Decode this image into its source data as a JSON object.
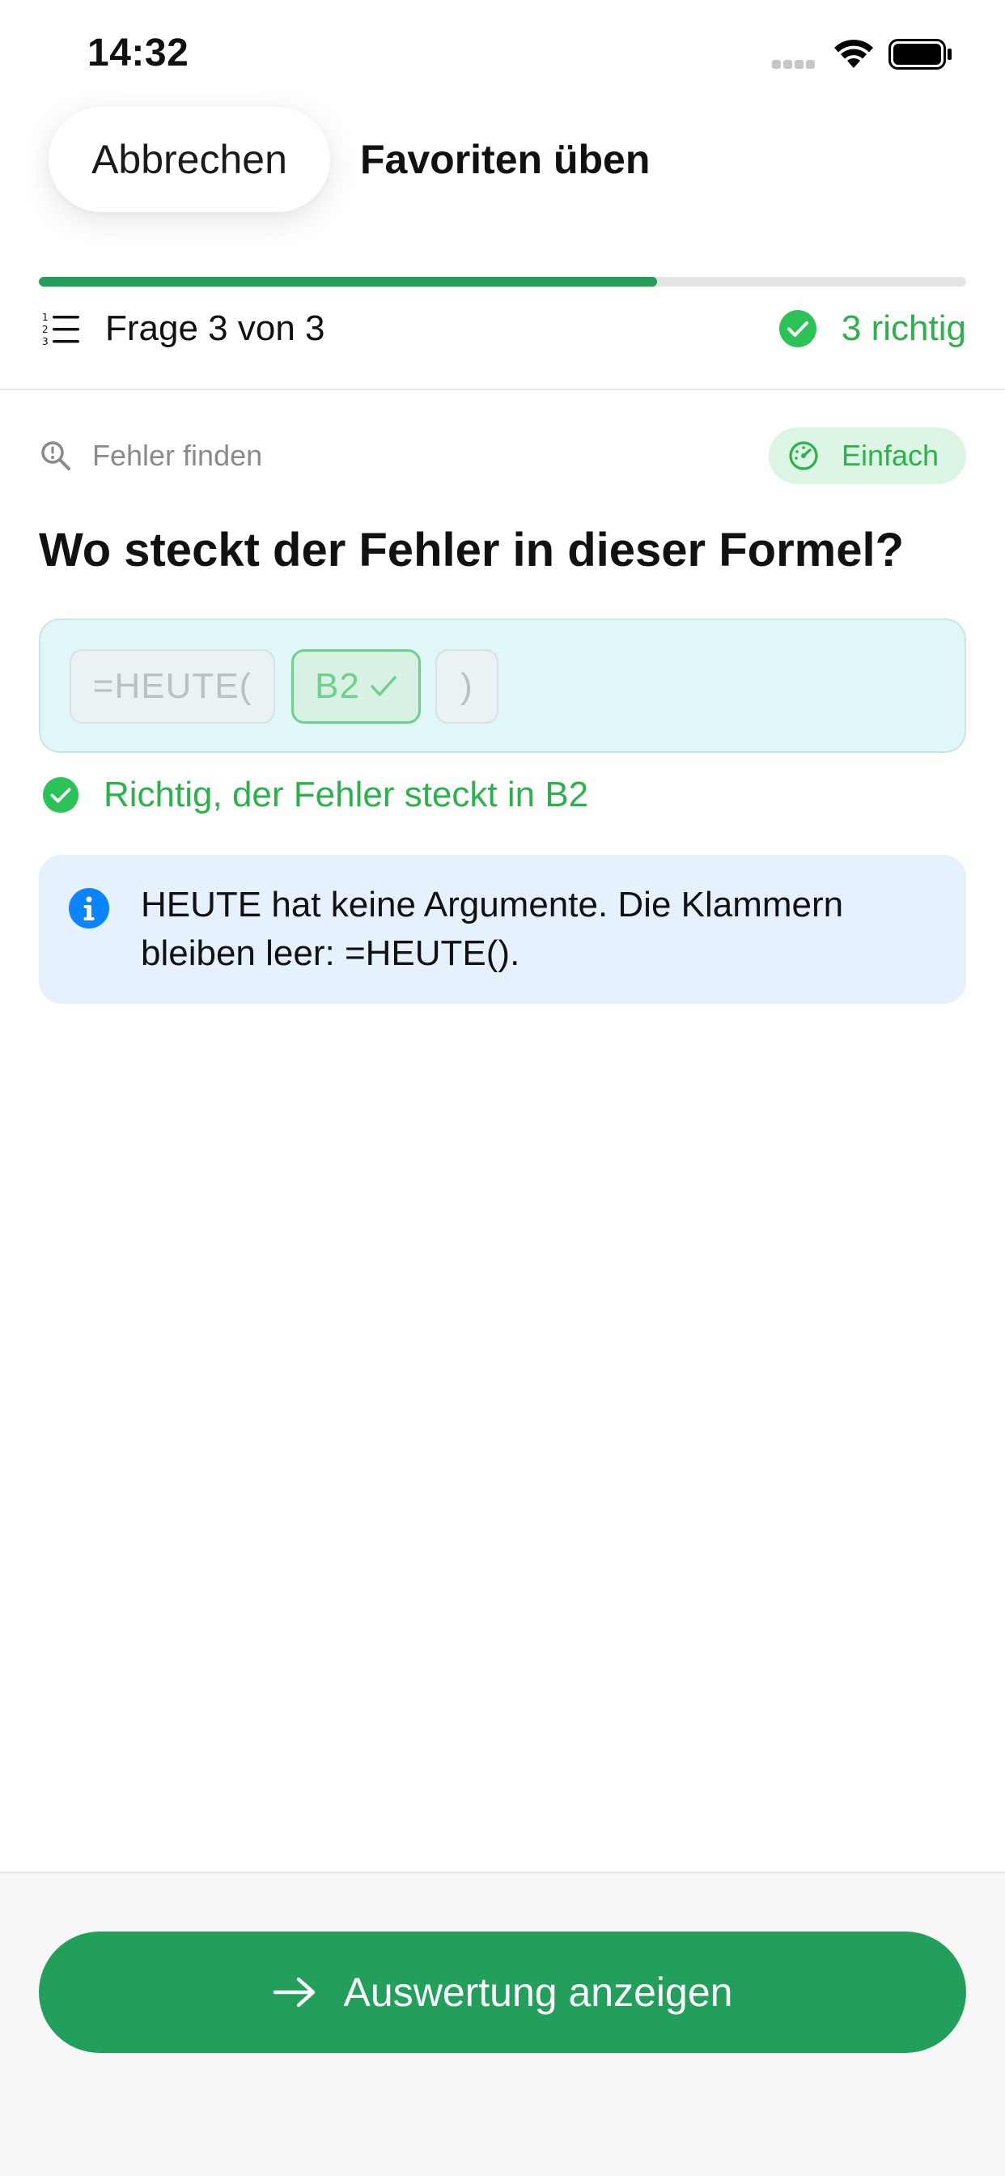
{
  "status_bar": {
    "time": "14:32",
    "signal_icon": "cellular-dots-icon",
    "wifi_icon": "wifi-icon",
    "battery_icon": "battery-icon"
  },
  "nav": {
    "cancel_label": "Abbrechen",
    "title": "Favoriten üben"
  },
  "progress": {
    "fraction": 0.667,
    "counter_label": "Frage 3 von 3",
    "counter_icon": "numbered-list-icon",
    "correct_label": "3 richtig",
    "correct_icon": "checkmark-circle-icon"
  },
  "question": {
    "category_label": "Fehler finden",
    "category_icon": "magnifier-exclamation-icon",
    "difficulty_label": "Einfach",
    "difficulty_icon": "gauge-icon",
    "text": "Wo steckt der Fehler in dieser Formel?",
    "tokens": [
      {
        "text": "=HEUTE(",
        "state": "neutral"
      },
      {
        "text": "B2",
        "state": "correct"
      },
      {
        "text": ")",
        "state": "neutral"
      }
    ]
  },
  "feedback": {
    "label": "Richtig, der Fehler steckt in B2",
    "icon": "checkmark-circle-icon"
  },
  "info": {
    "icon": "info-circle-icon",
    "text": "HEUTE hat keine Argumente. Die Klammern bleiben leer: =HEUTE()."
  },
  "footer": {
    "button_label": "Auswertung anzeigen",
    "button_icon": "arrow-right-icon"
  },
  "colors": {
    "accent": "#229f5b",
    "success": "#2bb24c",
    "info": "#0a84ff"
  }
}
